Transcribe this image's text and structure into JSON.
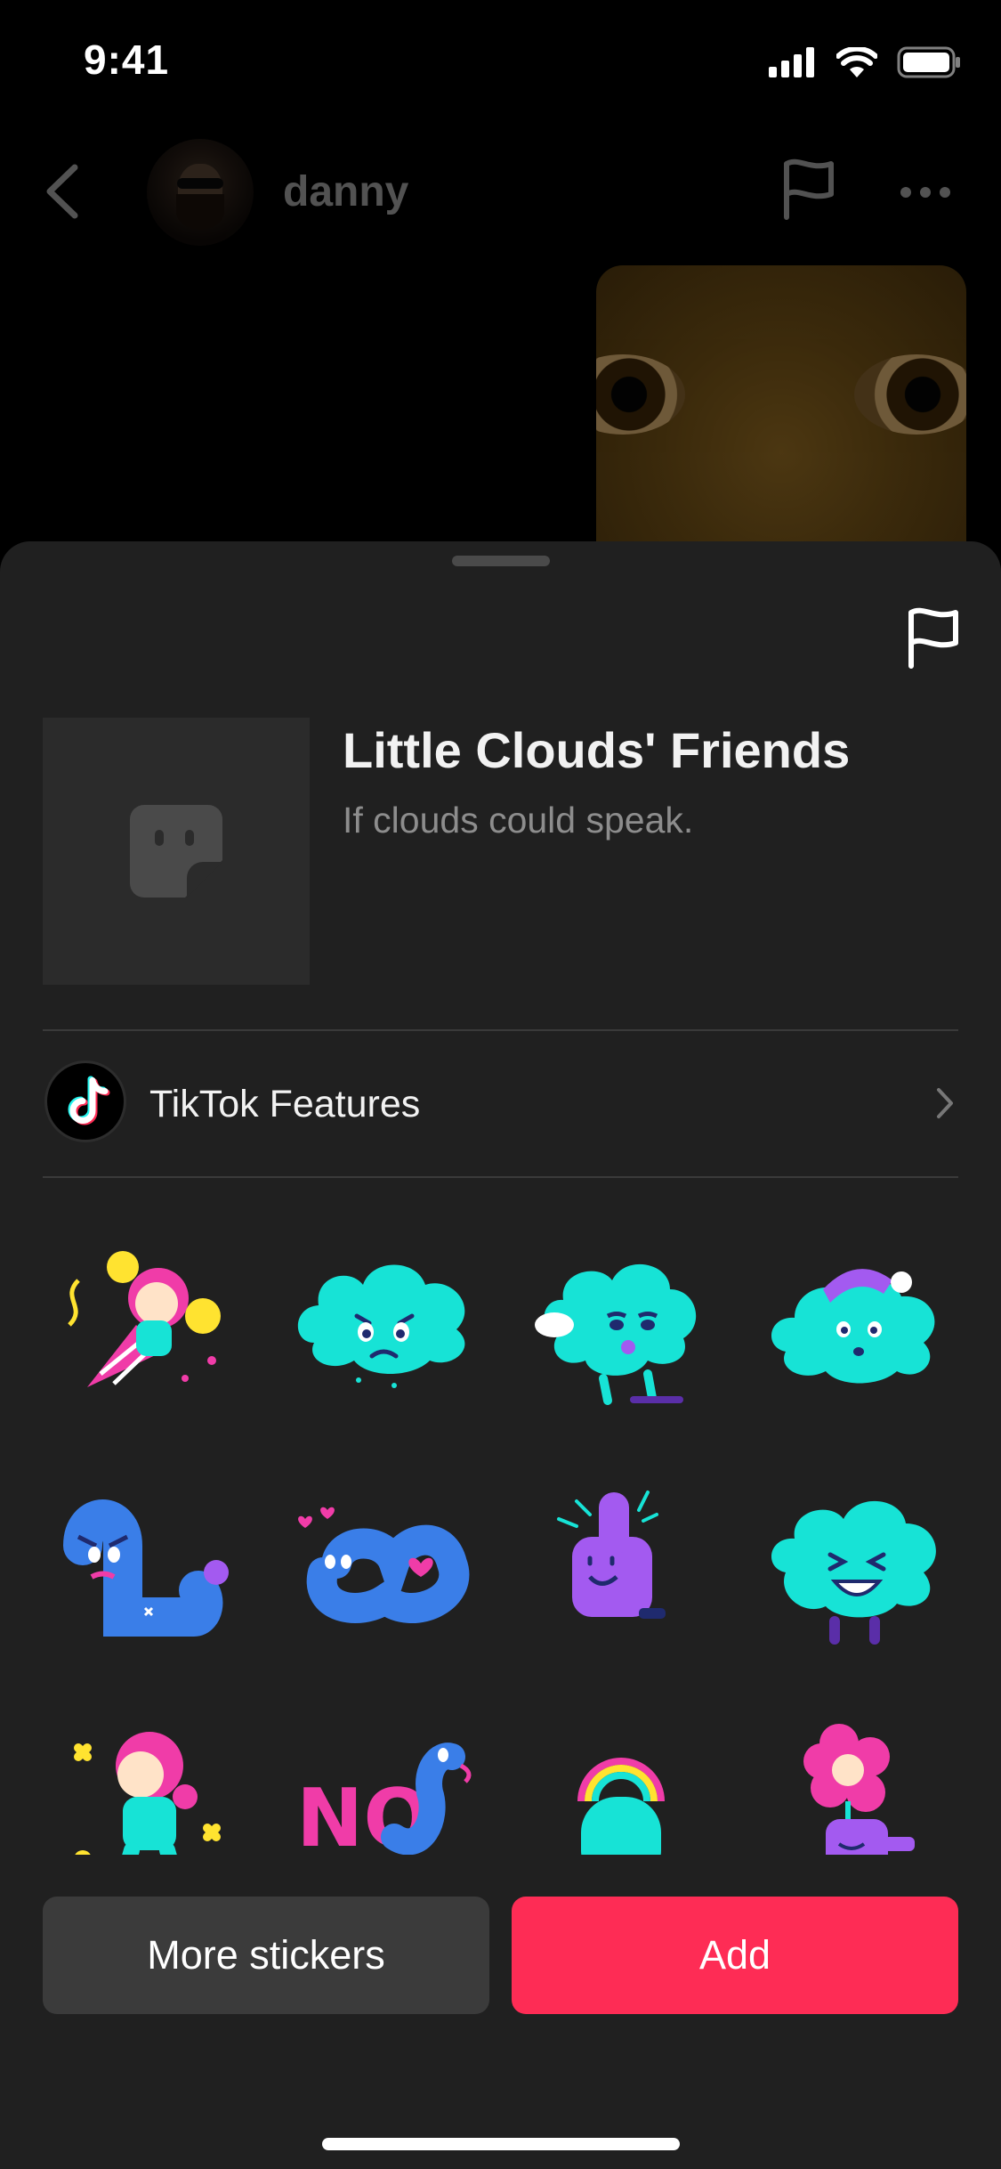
{
  "status_bar": {
    "time": "9:41",
    "icons": [
      "cellular-signal-icon",
      "wifi-icon",
      "battery-icon"
    ]
  },
  "chat_header": {
    "contact_name": "danny",
    "icons": [
      "back-arrow-icon",
      "avatar",
      "flag-icon",
      "more-icon"
    ]
  },
  "sticker_pack": {
    "title": "Little Clouds' Friends",
    "subtitle": "If clouds could speak.",
    "creator": "TikTok Features",
    "stickers": [
      "party-girl-sticker",
      "sad-cloud-sticker",
      "blowing-cloud-sticker",
      "sleepy-cloud-sticker",
      "flexing-worm-sticker",
      "love-worm-sticker",
      "thumbs-up-sticker",
      "laughing-cloud-sticker",
      "dancing-girl-sticker",
      "no-worm-sticker",
      "rainbow-cloud-sticker",
      "flower-hand-sticker"
    ]
  },
  "buttons": {
    "more_stickers": "More stickers",
    "add": "Add"
  },
  "colors": {
    "sheet_background": "#202020",
    "add_button": "#fe2c55",
    "secondary_button": "#3b3b3b",
    "sticker_teal": "#17e3d6",
    "sticker_blue": "#3a7ee8",
    "sticker_pink": "#f03ca8",
    "sticker_purple": "#a35af0"
  }
}
